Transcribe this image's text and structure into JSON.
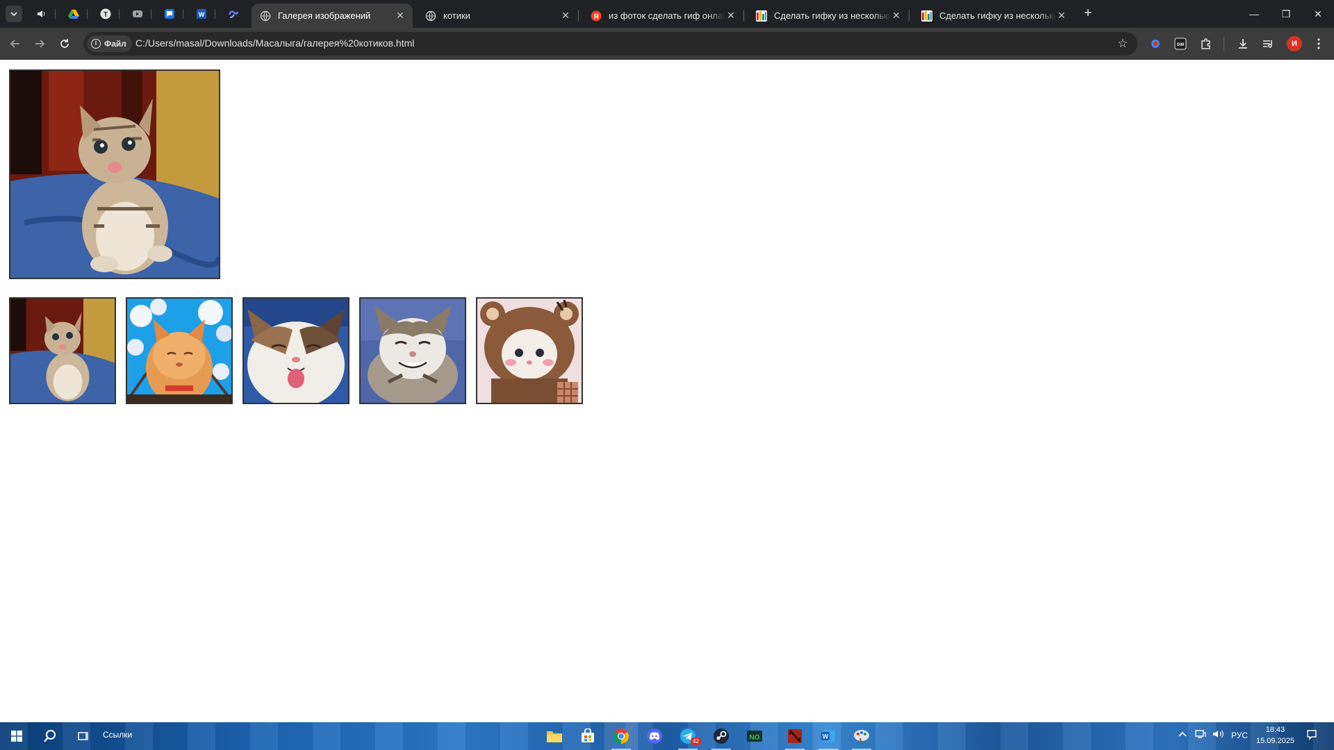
{
  "browser": {
    "pinned_tabs": [
      {
        "icon": "speaker-tab-icon"
      },
      {
        "icon": "google-drive-icon"
      },
      {
        "icon": "t-app-icon"
      },
      {
        "icon": "video-icon"
      },
      {
        "icon": "chat-icon"
      },
      {
        "icon": "word-icon"
      },
      {
        "icon": "swirl-app-icon"
      }
    ],
    "tabs": [
      {
        "title": "Галерея изображений",
        "active": true,
        "icon": "globe-icon"
      },
      {
        "title": "котики",
        "active": false,
        "icon": "globe-icon"
      },
      {
        "title": "из фоток сделать гиф онлайн",
        "active": false,
        "icon": "yandex-icon"
      },
      {
        "title": "Сделать гифку из нескольких",
        "active": false,
        "icon": "gif-site-icon"
      },
      {
        "title": "Сделать гифку из нескольких",
        "active": false,
        "icon": "gif-site-icon"
      }
    ],
    "new_tab": "+",
    "close_glyph": "✕",
    "window_controls": {
      "minimize": "—",
      "restore": "❐",
      "close": "✕"
    },
    "omnibox": {
      "security_chip": "Файл",
      "url": "C:/Users/masal/Downloads/Масалыга/галерея%20котиков.html"
    },
    "profile_initial": "И"
  },
  "gallery": {
    "main_image": "kitten-on-blue-blanket",
    "thumbnails": [
      {
        "name": "kitten-on-blue-blanket"
      },
      {
        "name": "ginger-cat-cherry-blossom"
      },
      {
        "name": "cat-tongue-out"
      },
      {
        "name": "tabby-cat-grinning"
      },
      {
        "name": "cat-in-bear-hat"
      }
    ]
  },
  "taskbar": {
    "links_label": "Ссылки",
    "language": "РУС",
    "time": "18:43",
    "date": "15.09.2025",
    "telegram_badge": "42"
  }
}
